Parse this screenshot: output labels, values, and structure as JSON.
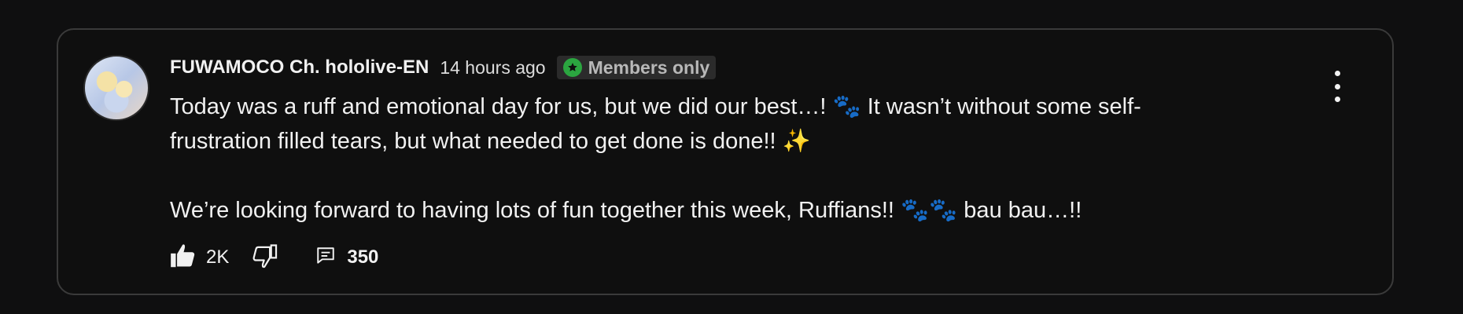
{
  "comment": {
    "author": "FUWAMOCO Ch. hololive-EN",
    "time": "14 hours ago",
    "badge": {
      "label": "Members only",
      "icon": "star-icon",
      "color": "#2ba640"
    },
    "text": "Today was a ruff and emotional day for us, but we did our best…! 🐾 It wasn’t without some self-\nfrustration filled tears, but what needed to get done is done!! ✨\n\nWe’re looking forward to having lots of fun together this week, Ruffians!! 🐾🐾 bau bau…!!"
  },
  "actions": {
    "likes": "2K",
    "replies": "350"
  }
}
